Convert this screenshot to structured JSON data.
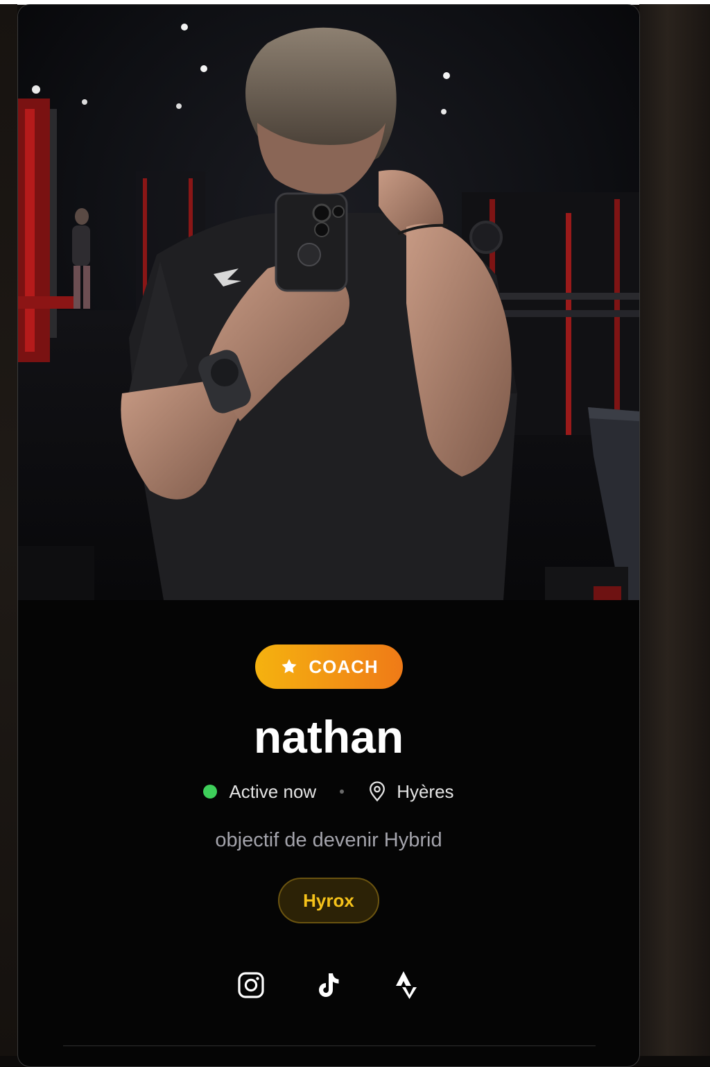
{
  "profile": {
    "photo_alt": "",
    "role_badge": "COACH",
    "name": "nathan",
    "status": "Active now",
    "location": "Hyères",
    "bio": "objectif de devenir Hybrid",
    "tags": [
      "Hyrox"
    ]
  },
  "socials": [
    {
      "icon": "instagram-icon"
    },
    {
      "icon": "tiktok-icon"
    },
    {
      "icon": "strava-icon"
    }
  ],
  "colors": {
    "badge_start": "#f5b20f",
    "badge_end": "#ef7a17",
    "status_online": "#3ecf5a",
    "tag_text": "#f5c21a",
    "card_background": "#050505"
  }
}
